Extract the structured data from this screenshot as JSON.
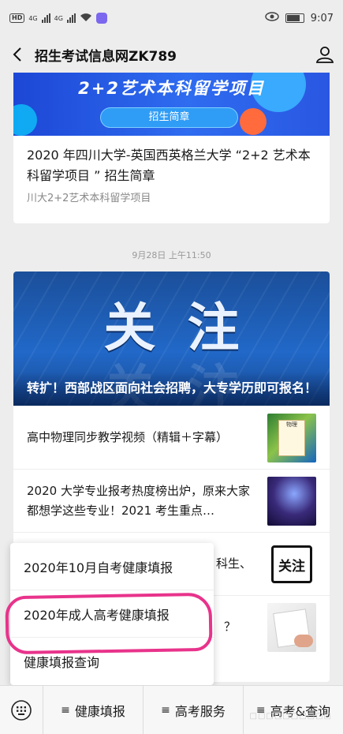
{
  "status_bar": {
    "time": "9:07",
    "hd": "HD",
    "net1": "4G",
    "net2": "4G"
  },
  "nav": {
    "title": "招生考试信息网ZK789"
  },
  "card1": {
    "banner_title": "2+2艺术本科留学项目",
    "banner_button": "招生简章",
    "title": "2020 年四川大学-英国西英格兰大学 “2+2 艺术本科留学项目 ” 招生简章",
    "subtitle": "川大2+2艺术本科留学项目"
  },
  "timestamp": "9月28日 上午11:50",
  "card2": {
    "banner_big": "关注",
    "banner_ghost": "关注",
    "banner_caption": "转扩！西部战区面向社会招聘，大专学历即可报名！",
    "articles": [
      {
        "title": "高中物理同步教学视频（精辑＋字幕）",
        "thumb_label": "物理"
      },
      {
        "title": "2020 大学专业报考热度榜出炉，原来大家都想学这些专业！2021 考生重点…"
      },
      {
        "title": "科生、",
        "thumb_label": "关注"
      },
      {
        "title": "？"
      }
    ]
  },
  "popup_menu": {
    "items": [
      "2020年10月自考健康填报",
      "2020年成人高考健康填报",
      "健康填报查询"
    ]
  },
  "bottom_menu": {
    "items": [
      "健康填报",
      "高考服务",
      "高考&查询"
    ],
    "hamburger": "≡"
  },
  "watermark": "□□□□□□□□□□",
  "colors": {
    "highlight": "#e8338b",
    "banner_blue": "#1d47d6"
  }
}
